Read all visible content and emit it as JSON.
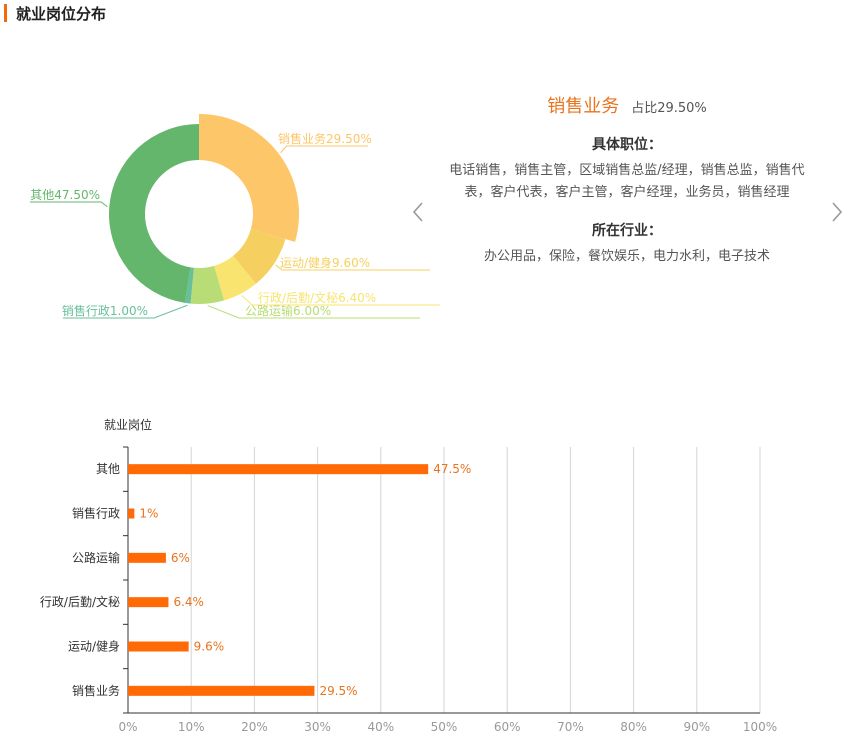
{
  "header": {
    "title": "就业岗位分布"
  },
  "detail": {
    "name": "销售业务",
    "share": "占比29.50%",
    "positions_title": "具体职位：",
    "positions": "电话销售，销售主管，区域销售总监/经理，销售总监，销售代表，客户代表，客户主管，客户经理，业务员，销售经理",
    "industries_title": "所在行业：",
    "industries": "办公用品，保险，餐饮娱乐，电力水利，电子技术"
  },
  "nav": {
    "prev_icon": "chevron-left-icon",
    "next_icon": "chevron-right-icon"
  },
  "chart_data": [
    {
      "type": "pie",
      "variant": "donut",
      "highlighted": "销售业务",
      "slices": [
        {
          "name": "销售业务",
          "value": 29.5,
          "label": "销售业务29.50%",
          "color": "#fdc668"
        },
        {
          "name": "运动/健身",
          "value": 9.6,
          "label": "运动/健身9.60%",
          "color": "#f5d060"
        },
        {
          "name": "行政/后勤/文秘",
          "value": 6.4,
          "label": "行政/后勤/文秘6.40%",
          "color": "#f8e46f"
        },
        {
          "name": "公路运输",
          "value": 6.0,
          "label": "公路运输6.00%",
          "color": "#b8dc76"
        },
        {
          "name": "销售行政",
          "value": 1.0,
          "label": "销售行政1.00%",
          "color": "#68bf9c"
        },
        {
          "name": "其他",
          "value": 47.5,
          "label": "其他47.50%",
          "color": "#65b66d"
        }
      ]
    },
    {
      "type": "bar",
      "orientation": "horizontal",
      "ylabel": "就业岗位",
      "categories": [
        "其他",
        "销售行政",
        "公路运输",
        "行政/后勤/文秘",
        "运动/健身",
        "销售业务"
      ],
      "values": [
        47.5,
        1,
        6,
        6.4,
        9.6,
        29.5
      ],
      "value_labels": [
        "47.5%",
        "1%",
        "6%",
        "6.4%",
        "9.6%",
        "29.5%"
      ],
      "xlim": [
        0,
        100
      ],
      "xticks": [
        "0%",
        "10%",
        "20%",
        "30%",
        "40%",
        "50%",
        "60%",
        "70%",
        "80%",
        "90%",
        "100%"
      ],
      "grid": true,
      "color": "#ff6a06"
    }
  ]
}
